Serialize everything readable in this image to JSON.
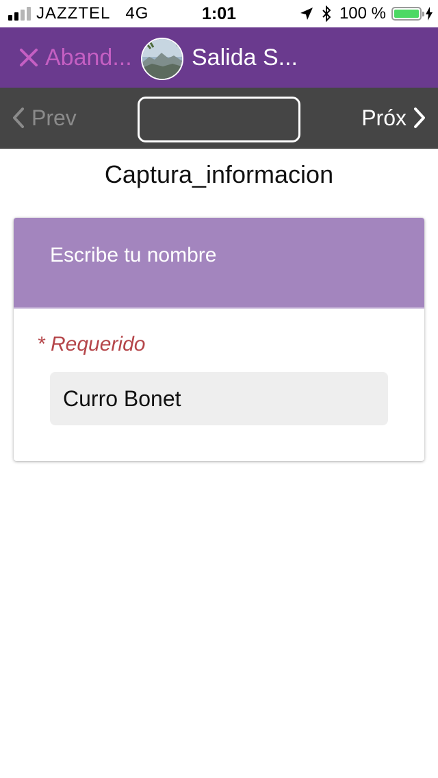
{
  "status_bar": {
    "carrier": "JAZZTEL",
    "network": "4G",
    "time": "1:01",
    "battery_percent": "100 %",
    "signal_bars_active": 2,
    "signal_bars_total": 4,
    "icons": [
      "signal-bars-icon",
      "location-arrow-icon",
      "bluetooth-icon",
      "battery-icon",
      "charging-bolt-icon"
    ]
  },
  "header": {
    "abandon_label": "Aband...",
    "title": "Salida S...",
    "background_color": "#6a3a8e",
    "abandon_color": "#c55fc3"
  },
  "navbar": {
    "prev_label": "Prev",
    "next_label": "Próx",
    "input_value": ""
  },
  "page": {
    "heading": "Captura_informacion"
  },
  "question_card": {
    "question": "Escribe tu nombre",
    "required_label": "* Requerido",
    "answer_value": "Curro Bonet",
    "header_color": "#a385be",
    "required_color": "#b5464a"
  }
}
